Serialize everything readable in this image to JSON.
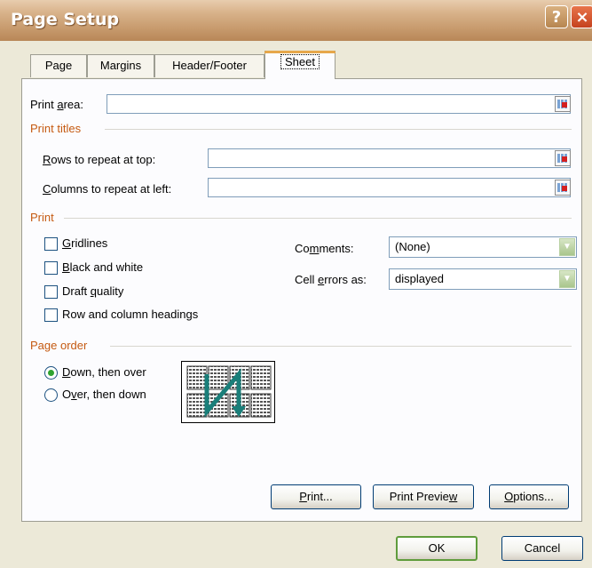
{
  "window": {
    "title": "Page Setup",
    "help_glyph": "?",
    "close_glyph": "×"
  },
  "tabs": [
    {
      "label": "Page",
      "active": false
    },
    {
      "label": "Margins",
      "active": false
    },
    {
      "label": "Header/Footer",
      "active": false
    },
    {
      "label": "Sheet",
      "active": true
    }
  ],
  "print_area": {
    "label_pre": "Print ",
    "label_key": "a",
    "label_post": "rea:",
    "value": ""
  },
  "print_titles": {
    "heading": "Print titles",
    "rows": {
      "label_key": "R",
      "label_post": "ows to repeat at top:",
      "value": ""
    },
    "columns": {
      "label_key": "C",
      "label_post": "olumns to repeat at left:",
      "value": ""
    }
  },
  "print": {
    "heading": "Print",
    "gridlines": {
      "label_key": "G",
      "label_post": "ridlines",
      "checked": false
    },
    "black_white": {
      "label_key": "B",
      "label_post": "lack and white",
      "checked": false
    },
    "draft": {
      "label_pre": "Draft ",
      "label_key": "q",
      "label_post": "uality",
      "checked": false
    },
    "headings": {
      "label": "Row and column headings",
      "checked": false
    },
    "comments": {
      "label_pre": "Co",
      "label_key": "m",
      "label_post": "ments:",
      "value": "(None)"
    },
    "cell_errors": {
      "label_pre": "Cell ",
      "label_key": "e",
      "label_post": "rrors as:",
      "value": "displayed"
    }
  },
  "page_order": {
    "heading": "Page order",
    "down_then_over": {
      "label_key": "D",
      "label_post": "own, then over",
      "selected": true
    },
    "over_then_down": {
      "label_pre": "O",
      "label_key": "v",
      "label_post": "er, then down",
      "selected": false
    }
  },
  "buttons": {
    "print": {
      "label_key": "P",
      "label_post": "rint..."
    },
    "preview": {
      "label_pre": "Print Previe",
      "label_key": "w",
      "label_post": ""
    },
    "options": {
      "label_key": "O",
      "label_post": "ptions..."
    },
    "ok": "OK",
    "cancel": "Cancel"
  },
  "colors": {
    "section_heading": "#c55a11",
    "accent_tab": "#e6a74b",
    "arrow": "#1a7f7a"
  }
}
